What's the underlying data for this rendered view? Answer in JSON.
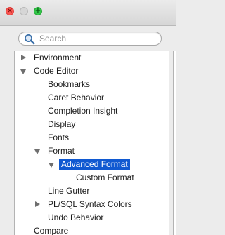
{
  "search": {
    "placeholder": "Search"
  },
  "tree": {
    "items": [
      {
        "label": "Environment",
        "expander": "collapsed"
      },
      {
        "label": "Code Editor",
        "expander": "expanded"
      },
      {
        "label": "Bookmarks",
        "expander": "none"
      },
      {
        "label": "Caret Behavior",
        "expander": "none"
      },
      {
        "label": "Completion Insight",
        "expander": "none"
      },
      {
        "label": "Display",
        "expander": "none"
      },
      {
        "label": "Fonts",
        "expander": "none"
      },
      {
        "label": "Format",
        "expander": "expanded"
      },
      {
        "label": "Advanced Format",
        "expander": "expanded",
        "selected": true
      },
      {
        "label": "Custom Format",
        "expander": "none"
      },
      {
        "label": "Line Gutter",
        "expander": "none"
      },
      {
        "label": "PL/SQL Syntax Colors",
        "expander": "collapsed"
      },
      {
        "label": "Undo Behavior",
        "expander": "none"
      },
      {
        "label": "Compare",
        "expander": "none"
      }
    ]
  },
  "colors": {
    "selection": "#1059d1",
    "close_button": "#fc5753",
    "zoom_button": "#34c84a"
  }
}
